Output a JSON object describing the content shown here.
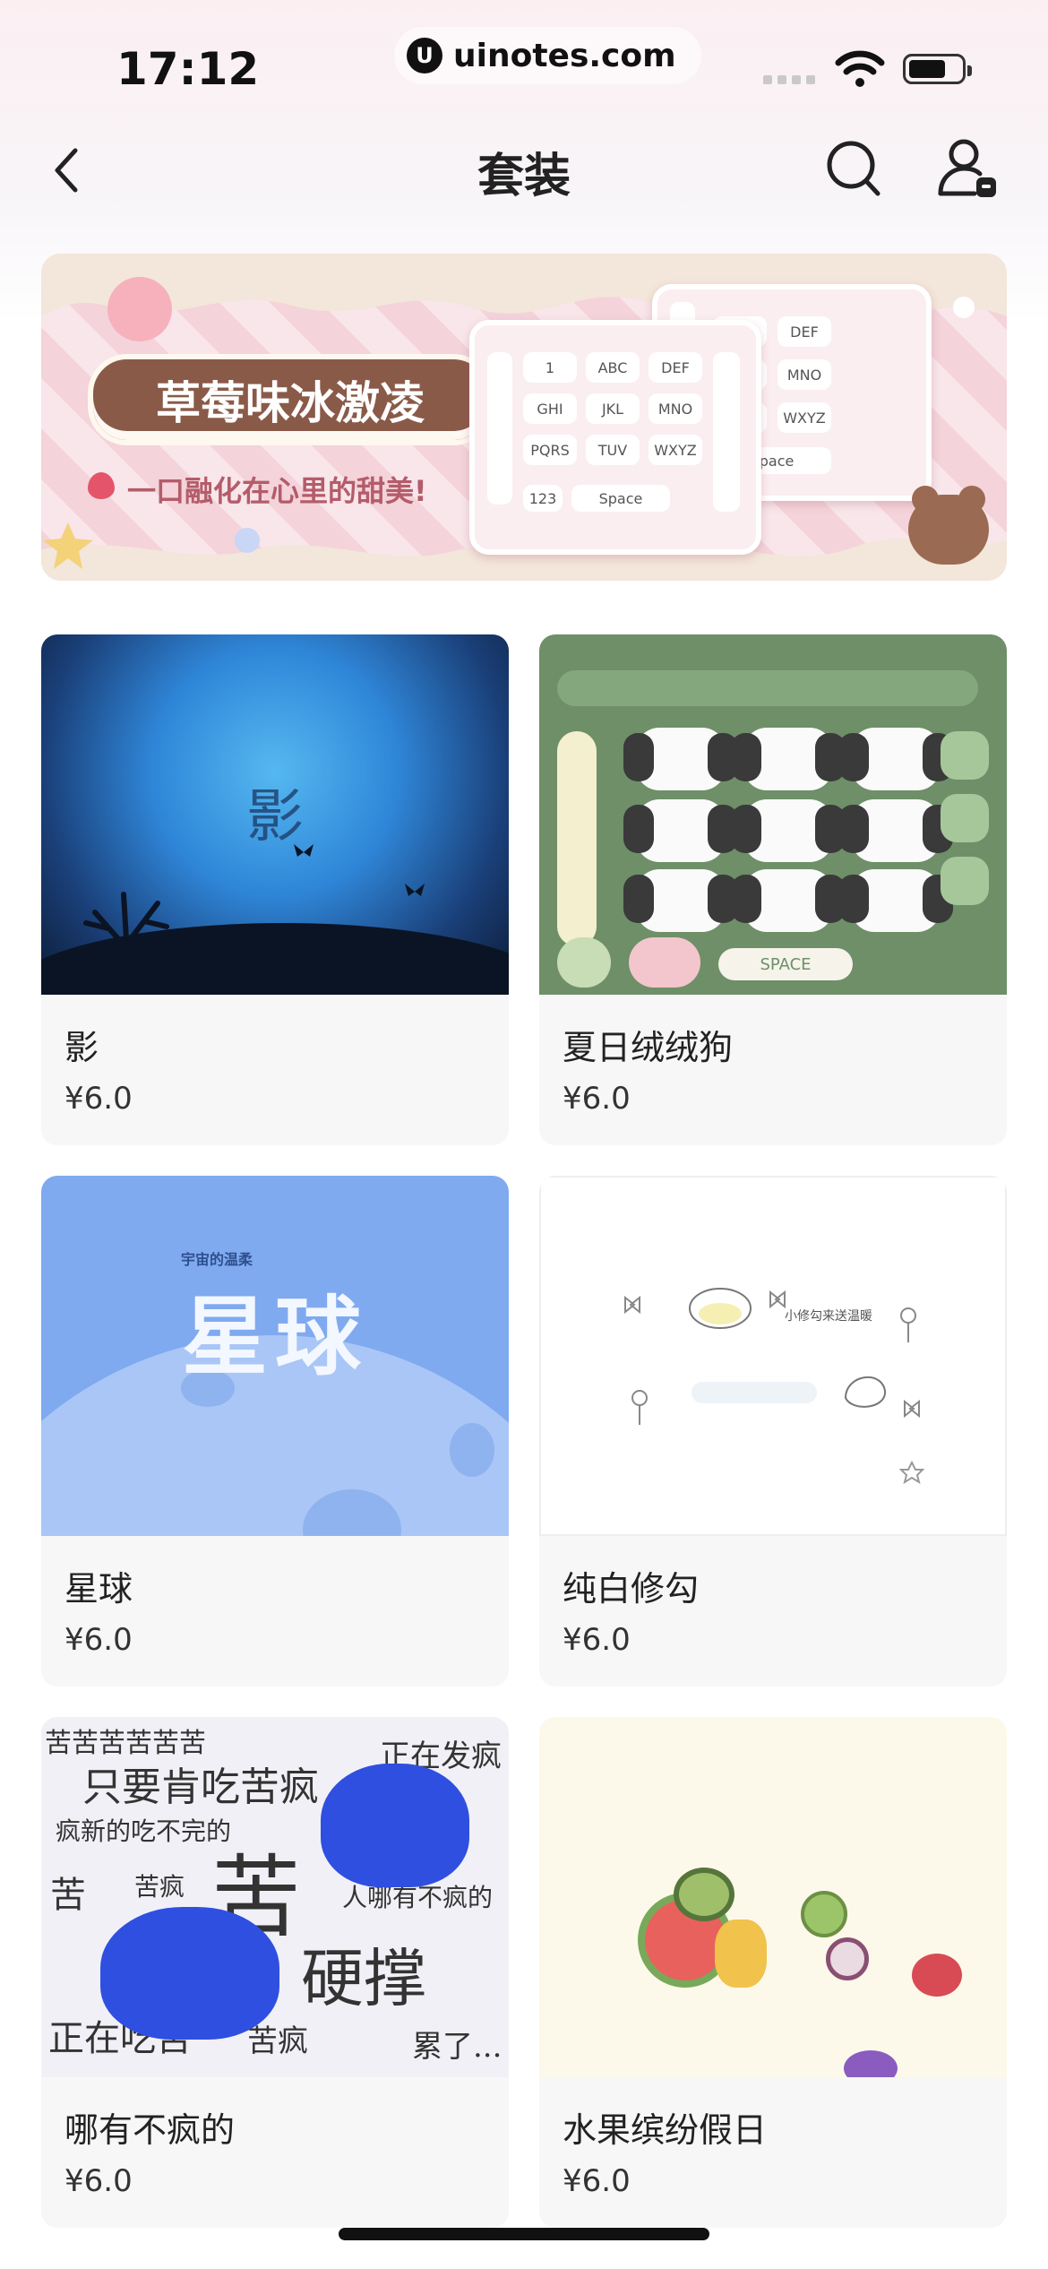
{
  "status_bar": {
    "time": "17:12",
    "url": "uinotes.com",
    "url_logo": "U"
  },
  "nav": {
    "title": "套装",
    "back_icon": "chevron-left-icon",
    "search_icon": "search-icon",
    "account_icon": "user-settings-icon"
  },
  "banner": {
    "title": "草莓味冰激凌",
    "subtitle": "一口融化在心里的甜美!",
    "keyboard_keys": [
      "1",
      "ABC",
      "DEF",
      "GHI",
      "JKL",
      "MNO",
      "PQRS",
      "TUV",
      "WXYZ",
      "Space",
      "123"
    ]
  },
  "products": [
    {
      "name": "影",
      "price": "¥6.0",
      "thumb_text": "影"
    },
    {
      "name": "夏日绒绒狗",
      "price": "¥6.0",
      "thumb_text": "SPACE"
    },
    {
      "name": "星球",
      "price": "¥6.0",
      "thumb_text": "星球",
      "thumb_subtext": "宇宙的温柔"
    },
    {
      "name": "纯白修勾",
      "price": "¥6.0",
      "thumb_text": "小修勾来送温暖"
    },
    {
      "name": "哪有不疯的",
      "price": "¥6.0",
      "thumb_text": [
        "苦苦苦苦苦苦",
        "只要肯吃苦疯",
        "正在发疯",
        "疯新的吃不完的",
        "苦",
        "苦疯",
        "人哪有不疯的",
        "苦",
        "硬撑",
        "正在吃苦",
        "苦疯",
        "累了..."
      ]
    },
    {
      "name": "水果缤纷假日",
      "price": "¥6.0"
    }
  ]
}
